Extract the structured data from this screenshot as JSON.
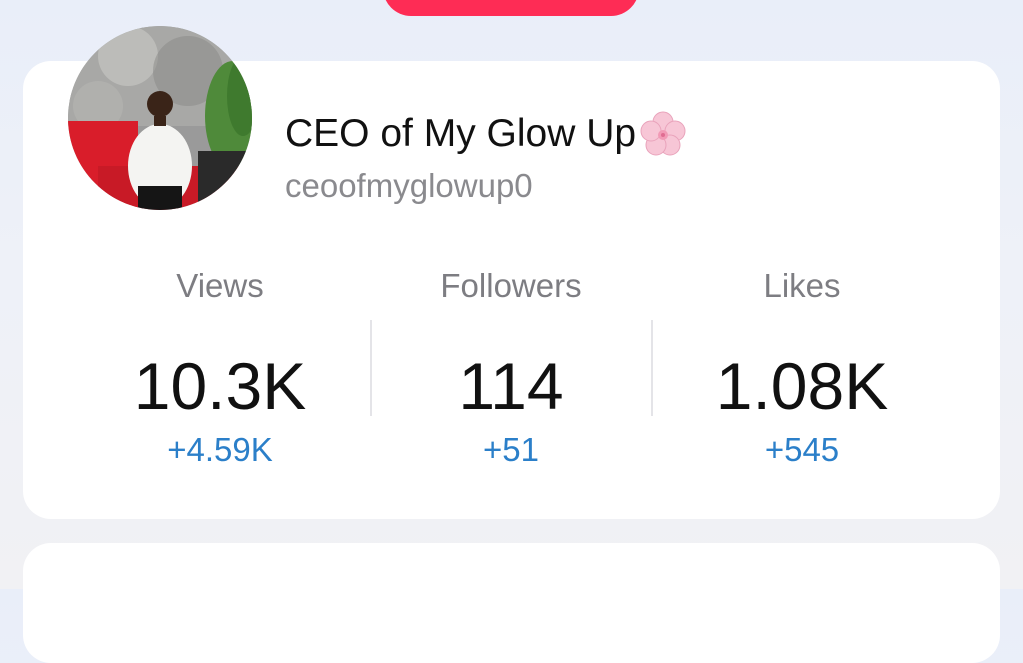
{
  "profile": {
    "display_name": "CEO of My Glow Up",
    "username": "ceoofmyglowup0"
  },
  "stats": [
    {
      "label": "Views",
      "value": "10.3K",
      "delta": "+4.59K"
    },
    {
      "label": "Followers",
      "value": "114",
      "delta": "+51"
    },
    {
      "label": "Likes",
      "value": "1.08K",
      "delta": "+545"
    }
  ],
  "icons": {
    "name_emoji": "cherry-blossom-icon"
  },
  "colors": {
    "accent": "#fe2c55",
    "delta": "#2b7fc9",
    "label": "#7d7d82"
  }
}
